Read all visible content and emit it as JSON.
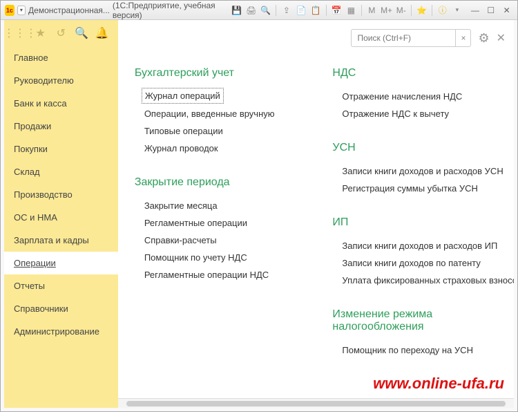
{
  "window": {
    "title_app": "Демонстрационная...",
    "title_suffix": "(1С:Предприятие, учебная версия)",
    "mem_m": "M",
    "mem_mplus": "M+",
    "mem_mminus": "M-"
  },
  "sidebar": {
    "items": [
      {
        "label": "Главное"
      },
      {
        "label": "Руководителю"
      },
      {
        "label": "Банк и касса"
      },
      {
        "label": "Продажи"
      },
      {
        "label": "Покупки"
      },
      {
        "label": "Склад"
      },
      {
        "label": "Производство"
      },
      {
        "label": "ОС и НМА"
      },
      {
        "label": "Зарплата и кадры"
      },
      {
        "label": "Операции",
        "active": true
      },
      {
        "label": "Отчеты"
      },
      {
        "label": "Справочники"
      },
      {
        "label": "Администрирование"
      }
    ]
  },
  "search": {
    "placeholder": "Поиск (Ctrl+F)"
  },
  "content": {
    "left": [
      {
        "title": "Бухгалтерский учет",
        "items": [
          {
            "label": "Журнал операций",
            "selected": true
          },
          {
            "label": "Операции, введенные вручную"
          },
          {
            "label": "Типовые операции"
          },
          {
            "label": "Журнал проводок"
          }
        ]
      },
      {
        "title": "Закрытие периода",
        "items": [
          {
            "label": "Закрытие месяца"
          },
          {
            "label": "Регламентные операции"
          },
          {
            "label": "Справки-расчеты"
          },
          {
            "label": "Помощник по учету НДС"
          },
          {
            "label": "Регламентные операции НДС"
          }
        ]
      }
    ],
    "right": [
      {
        "title": "НДС",
        "items": [
          {
            "label": "Отражение начисления НДС"
          },
          {
            "label": "Отражение НДС к вычету"
          }
        ]
      },
      {
        "title": "УСН",
        "items": [
          {
            "label": "Записи книги доходов и расходов УСН"
          },
          {
            "label": "Регистрация суммы убытка УСН"
          }
        ]
      },
      {
        "title": "ИП",
        "items": [
          {
            "label": "Записи книги доходов и расходов ИП"
          },
          {
            "label": "Записи книги доходов по патенту"
          },
          {
            "label": "Уплата фиксированных страховых взносов"
          }
        ]
      },
      {
        "title": "Изменение режима налогообложения",
        "items": [
          {
            "label": "Помощник по переходу на УСН"
          }
        ]
      }
    ]
  },
  "watermark": "www.online-ufa.ru"
}
